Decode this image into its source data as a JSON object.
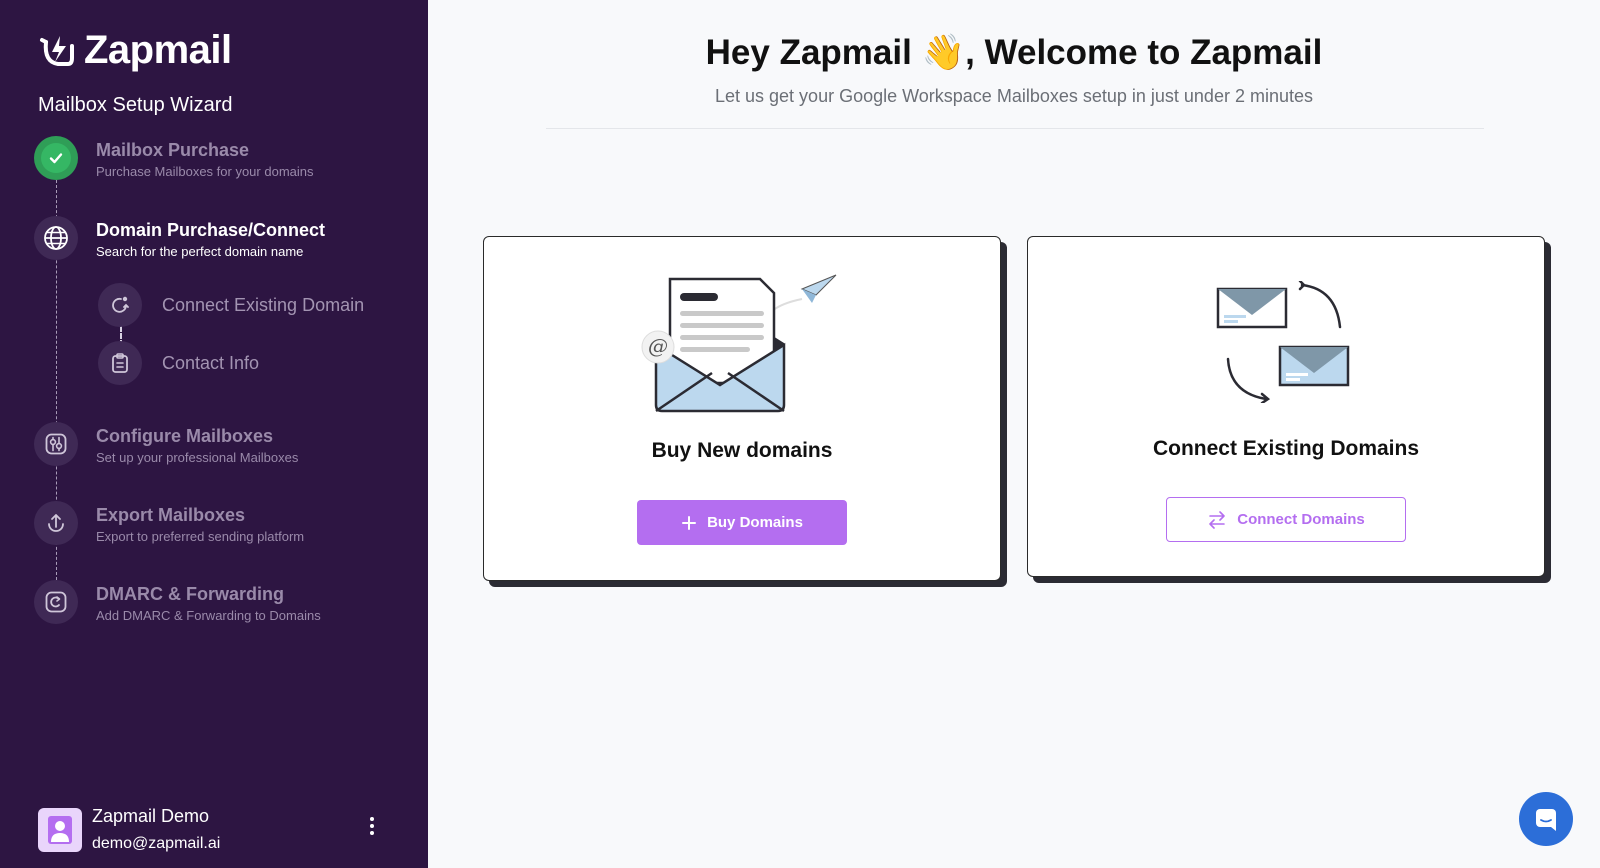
{
  "app": {
    "name": "Zapmail",
    "wizard_title": "Mailbox Setup Wizard"
  },
  "steps": [
    {
      "title": "Mailbox Purchase",
      "subtitle": "Purchase Mailboxes for your domains",
      "status": "done",
      "icon": "check-icon"
    },
    {
      "title": "Domain Purchase/Connect",
      "subtitle": "Search for the perfect domain name",
      "status": "active",
      "icon": "globe-icon"
    },
    {
      "title": "Configure Mailboxes",
      "subtitle": "Set up your professional Mailboxes",
      "status": "pending",
      "icon": "settings-sliders-icon"
    },
    {
      "title": "Export Mailboxes",
      "subtitle": "Export to preferred sending platform",
      "status": "pending",
      "icon": "upload-icon"
    },
    {
      "title": "DMARC & Forwarding",
      "subtitle": "Add DMARC & Forwarding to Domains",
      "status": "pending",
      "icon": "forward-icon"
    }
  ],
  "substeps": [
    {
      "label": "Connect Existing Domain",
      "icon": "refresh-icon"
    },
    {
      "label": "Contact Info",
      "icon": "clipboard-icon"
    }
  ],
  "user": {
    "name": "Zapmail Demo",
    "email": "demo@zapmail.ai"
  },
  "main": {
    "headline": "Hey Zapmail 👋, Welcome to Zapmail",
    "subline": "Let us get your Google Workspace Mailboxes setup in just under 2 minutes"
  },
  "cards": [
    {
      "title": "Buy New domains",
      "button_label": "Buy Domains",
      "button_icon": "plus-icon"
    },
    {
      "title": "Connect Existing Domains",
      "button_label": "Connect Domains",
      "button_icon": "swap-arrows-icon"
    }
  ],
  "colors": {
    "sidebar_bg": "#2d1542",
    "accent": "#b46ef0",
    "success": "#35b764",
    "chat": "#2c6ed8"
  }
}
